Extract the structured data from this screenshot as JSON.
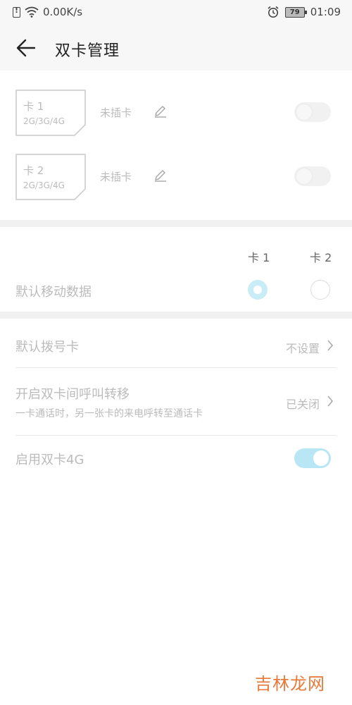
{
  "status_bar": {
    "network_speed": "0.00K/s",
    "battery_level": "79",
    "time": "01:09"
  },
  "header": {
    "title": "双卡管理"
  },
  "sim_cards": [
    {
      "name": "卡 1",
      "network": "2G/3G/4G",
      "status": "未插卡",
      "enabled": false
    },
    {
      "name": "卡 2",
      "network": "2G/3G/4G",
      "status": "未插卡",
      "enabled": false
    }
  ],
  "default_data": {
    "label": "默认移动数据",
    "columns": [
      "卡 1",
      "卡 2"
    ],
    "selected_index": 0
  },
  "settings": {
    "default_dial": {
      "title": "默认拨号卡",
      "value": "不设置"
    },
    "call_forward": {
      "title": "开启双卡间呼叫转移",
      "subtitle": "一卡通话时，另一张卡的来电呼转至通话卡",
      "value": "已关闭"
    },
    "dual_4g": {
      "title": "启用双卡4G",
      "enabled": true
    }
  },
  "watermark": "吉林龙网",
  "colors": {
    "accent": "#b9e6f4",
    "disabled_text": "#bbbbbb",
    "watermark": "#e8793a"
  }
}
